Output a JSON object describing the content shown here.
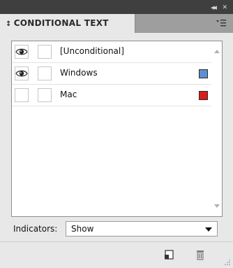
{
  "panel": {
    "title": "CONDITIONAL TEXT",
    "title_glyph": "↕"
  },
  "window_controls": {
    "collapse": "◀◀",
    "close": "✕"
  },
  "conditions": [
    {
      "name": "[Unconditional]",
      "visible": true,
      "color": null
    },
    {
      "name": "Windows",
      "visible": true,
      "color": "#5b8fd0"
    },
    {
      "name": "Mac",
      "visible": false,
      "color": "#d81e1e"
    }
  ],
  "indicators": {
    "label": "Indicators:",
    "value": "Show"
  },
  "colors": {
    "accent_blue": "#5b8fd0",
    "accent_red": "#d81e1e"
  }
}
